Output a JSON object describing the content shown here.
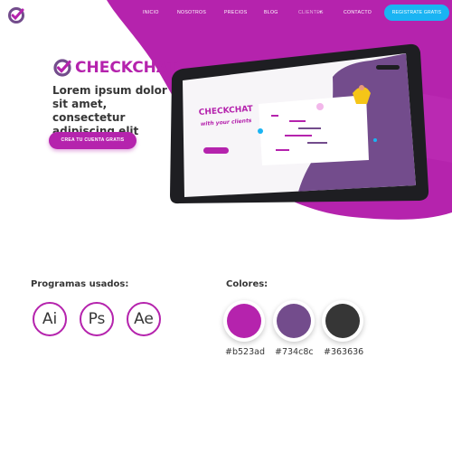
{
  "nav": {
    "links": [
      "INICIO",
      "NOSOTROS",
      "PRECIOS",
      "BLOG",
      "CLIENTES",
      "CONTACTO"
    ],
    "register_label": "REGISTRATE GRATIS"
  },
  "hero": {
    "brand": "CHECKCHAT",
    "headline": "Lorem ipsum dolor sit amet, consectetur adipiscing elit",
    "cta_label": "CREA TU CUENTA GRATIS",
    "screen_brand": "CHECKCHAT",
    "screen_tagline": "with your clients"
  },
  "programs": {
    "title": "Programas usados:",
    "items": [
      "Ai",
      "Ps",
      "Ae"
    ]
  },
  "colors": {
    "title": "Colores:",
    "swatches": [
      "#b523ad",
      "#734c8c",
      "#363636"
    ],
    "labels": [
      "#b523ad",
      "#734c8c",
      "#363636"
    ]
  },
  "theme": {
    "primary": "#b523ad",
    "secondary": "#734c8c",
    "dark": "#363636",
    "accent": "#1ab4f3"
  }
}
